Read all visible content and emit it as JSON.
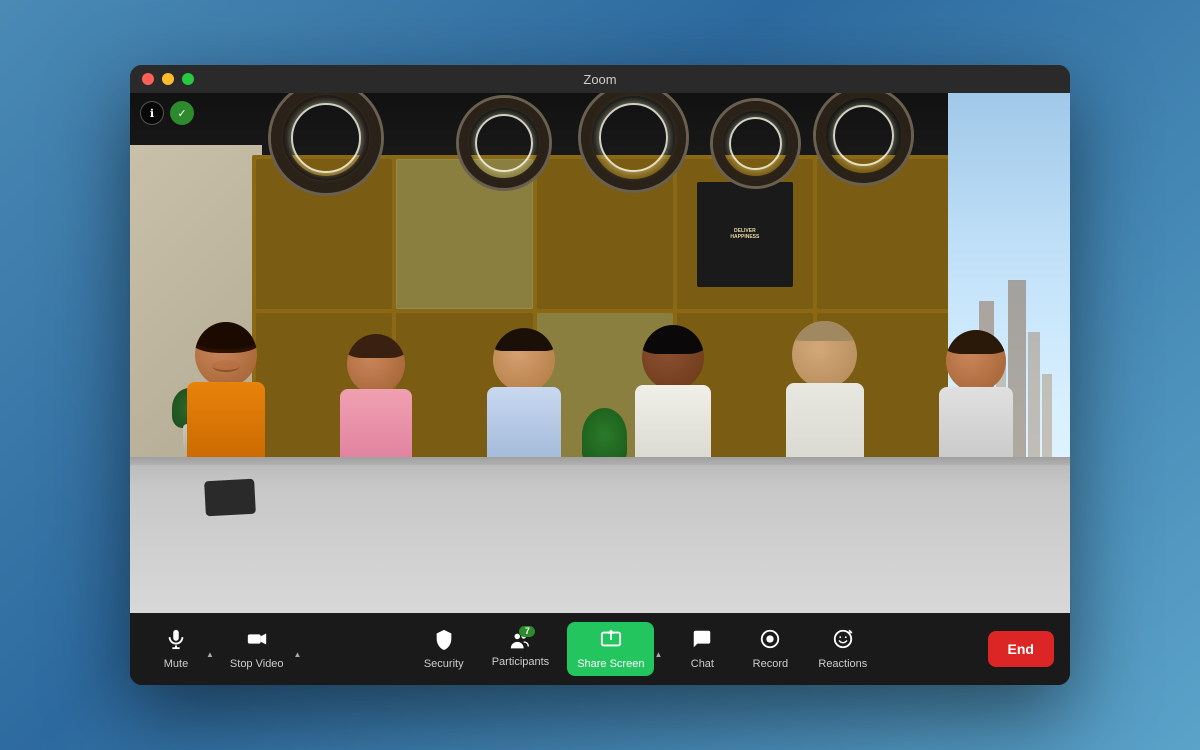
{
  "window": {
    "title": "Zoom"
  },
  "titlebar": {
    "title": "Zoom",
    "controls": {
      "close": "×",
      "minimize": "−",
      "maximize": "+"
    }
  },
  "topIcons": {
    "info": "ℹ",
    "shield": "✓"
  },
  "toolbar": {
    "mute": {
      "label": "Mute",
      "icon": "🎤"
    },
    "stopVideo": {
      "label": "Stop Video",
      "icon": "📹"
    },
    "security": {
      "label": "Security",
      "icon": "🛡"
    },
    "participants": {
      "label": "Participants",
      "icon": "👥",
      "count": "7"
    },
    "shareScreen": {
      "label": "Share Screen",
      "icon": "⬆"
    },
    "chat": {
      "label": "Chat",
      "icon": "💬"
    },
    "record": {
      "label": "Record",
      "icon": "⏺"
    },
    "reactions": {
      "label": "Reactions",
      "icon": "😊"
    },
    "end": {
      "label": "End"
    }
  },
  "colors": {
    "shareScreen": "#22c55e",
    "end": "#dc2626",
    "toolbar": "#1a1a1a",
    "titlebar": "#2a2a2a",
    "windowBg": "#1a1a1a",
    "shield": "#2d8a2d"
  }
}
